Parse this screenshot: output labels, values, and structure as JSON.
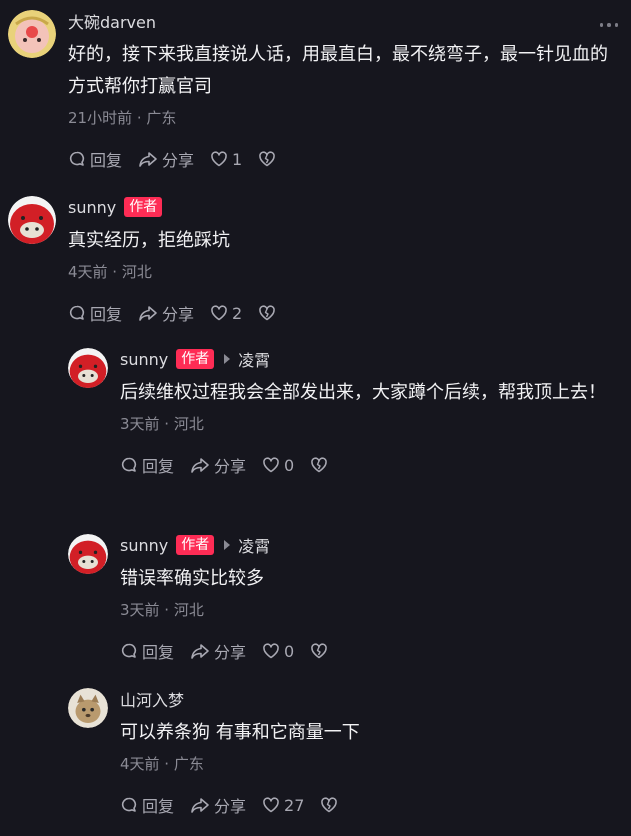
{
  "comments": [
    {
      "username": "大碗darven",
      "text": "好的，接下来我直接说人话，用最直白，最不绕弯子，最一针见血的方式帮你打赢官司",
      "meta": "21小时前 · 广东",
      "reply_label": "回复",
      "share_label": "分享",
      "likes": "1"
    },
    {
      "username": "sunny",
      "badge": "作者",
      "text": "真实经历，拒绝踩坑",
      "meta": "4天前 · 河北",
      "reply_label": "回复",
      "share_label": "分享",
      "likes": "2"
    },
    {
      "username": "sunny",
      "badge": "作者",
      "reply_to": "凌霄",
      "text": "后续维权过程我会全部发出来，大家蹲个后续，帮我顶上去！",
      "meta": "3天前 · 河北",
      "reply_label": "回复",
      "share_label": "分享",
      "likes": "0"
    },
    {
      "username": "sunny",
      "badge": "作者",
      "reply_to": "凌霄",
      "text": "错误率确实比较多",
      "meta": "3天前 · 河北",
      "reply_label": "回复",
      "share_label": "分享",
      "likes": "0"
    },
    {
      "username": "山河入梦",
      "text": "可以养条狗 有事和它商量一下",
      "meta": "4天前 · 广东",
      "reply_label": "回复",
      "share_label": "分享",
      "likes": "27"
    }
  ],
  "icons": {
    "more": "more-icon",
    "comment": "comment-icon",
    "share": "share-icon",
    "like": "heart-icon",
    "dislike": "broken-heart-icon",
    "reply_arrow": "caret-right-icon"
  },
  "colors": {
    "background": "#16161e",
    "author_badge": "#fe2c55",
    "meta_text": "#8b8b95"
  }
}
